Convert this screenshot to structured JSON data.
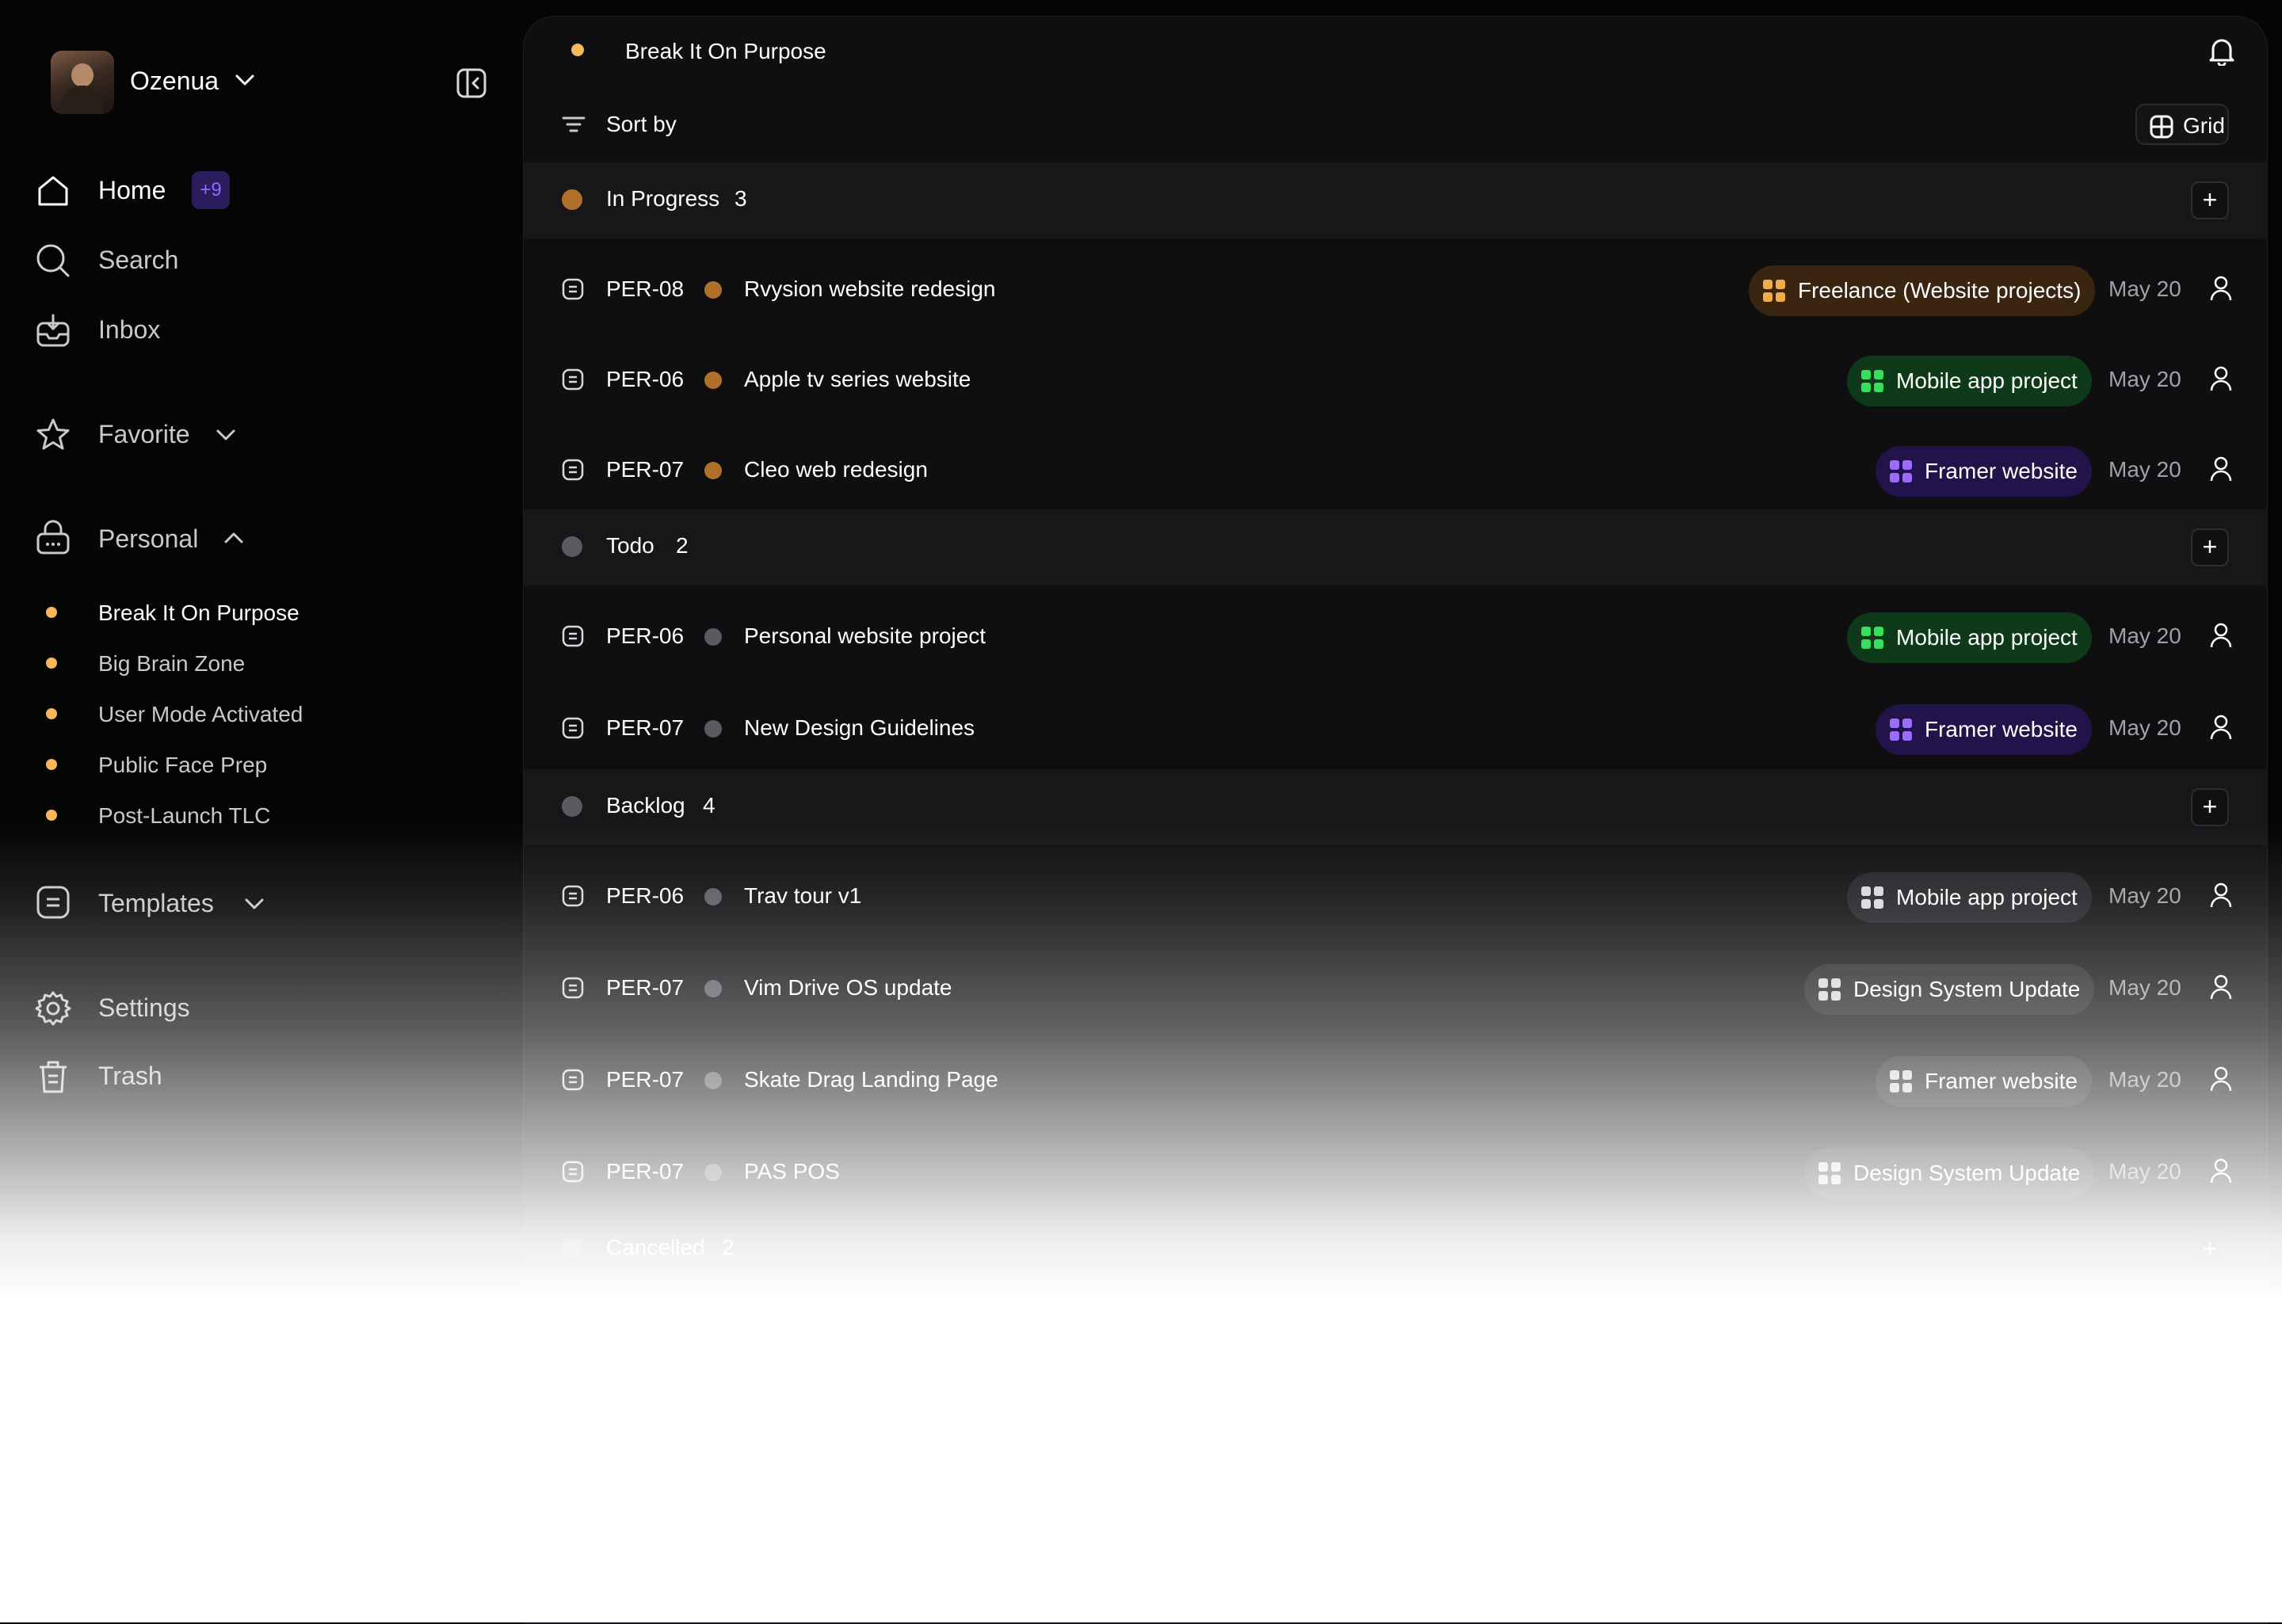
{
  "workspace": {
    "name": "Ozenua"
  },
  "nav": {
    "home": {
      "label": "Home",
      "badge": "+9"
    },
    "search": {
      "label": "Search"
    },
    "inbox": {
      "label": "Inbox"
    },
    "favorite": {
      "label": "Favorite"
    },
    "personal": {
      "label": "Personal",
      "items": [
        {
          "label": "Break It On Purpose"
        },
        {
          "label": "Big Brain Zone"
        },
        {
          "label": "User Mode Activated"
        },
        {
          "label": "Public Face Prep"
        },
        {
          "label": "Post-Launch TLC"
        }
      ]
    },
    "templates": {
      "label": "Templates"
    },
    "settings": {
      "label": "Settings"
    },
    "trash": {
      "label": "Trash"
    }
  },
  "project": {
    "title": "Break It On Purpose"
  },
  "toolbar": {
    "sort_label": "Sort by",
    "view_label": "Grid"
  },
  "sections": [
    {
      "name": "In Progress",
      "count": "3",
      "rows": [
        {
          "id": "PER-08",
          "title": "Rvysion website redesign",
          "tag": "Freelance (Website projects)",
          "date": "May 20"
        },
        {
          "id": "PER-06",
          "title": "Apple tv series website",
          "tag": "Mobile app project",
          "date": "May 20"
        },
        {
          "id": "PER-07",
          "title": "Cleo web redesign",
          "tag": "Framer website",
          "date": "May 20"
        }
      ]
    },
    {
      "name": "Todo",
      "count": "2",
      "rows": [
        {
          "id": "PER-06",
          "title": "Personal website project",
          "tag": "Mobile app project",
          "date": "May 20"
        },
        {
          "id": "PER-07",
          "title": "New Design Guidelines",
          "tag": "Framer website",
          "date": "May 20"
        }
      ]
    },
    {
      "name": "Backlog",
      "count": "4",
      "rows": [
        {
          "id": "PER-06",
          "title": "Trav tour v1",
          "tag": "Mobile app project",
          "date": "May 20"
        },
        {
          "id": "PER-07",
          "title": "Vim Drive OS update",
          "tag": "Design System Update",
          "date": "May 20"
        },
        {
          "id": "PER-07",
          "title": "Skate Drag Landing Page",
          "tag": "Framer website",
          "date": "May 20"
        },
        {
          "id": "PER-07",
          "title": "PAS POS",
          "tag": "Design System Update",
          "date": "May 20"
        }
      ]
    },
    {
      "name": "Cancelled",
      "count": "2",
      "rows": []
    }
  ],
  "colors": {
    "accent_dot": "#f5b85a",
    "in_progress": "#b0702a",
    "tag_freelance": "#f5a94a",
    "tag_mobile": "#36e05a",
    "tag_framer": "#9d6cff"
  }
}
